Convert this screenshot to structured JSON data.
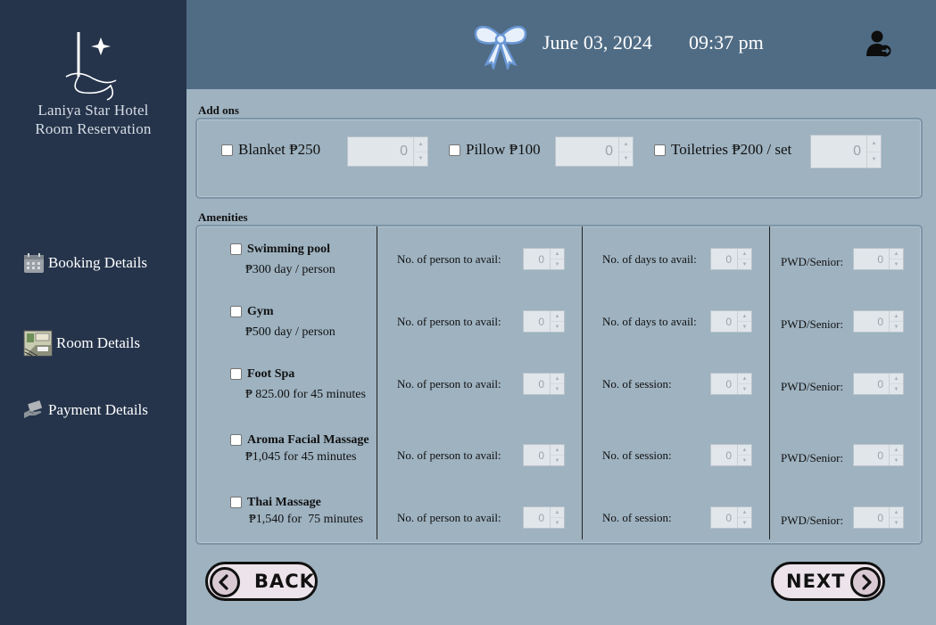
{
  "sidebar": {
    "hotel_name_line1": "Laniya Star Hotel",
    "hotel_name_line2": "Room Reservation",
    "nav": [
      {
        "label": "Booking Details",
        "icon": "calendar-icon"
      },
      {
        "label": "Room Details",
        "icon": "room-icon"
      },
      {
        "label": "Payment Details",
        "icon": "payment-icon"
      }
    ]
  },
  "header": {
    "date": "June 03, 2024",
    "time": "09:37 pm",
    "icons": [
      "bow-icon",
      "logout-user-icon"
    ]
  },
  "addons": {
    "section_label": "Add ons",
    "items": [
      {
        "label": "Blanket ₱250",
        "checked": false,
        "qty": "0"
      },
      {
        "label": "Pillow ₱100",
        "checked": false,
        "qty": "0"
      },
      {
        "label": "Toiletries ₱200 / set",
        "checked": false,
        "qty": "0"
      }
    ]
  },
  "amenities": {
    "section_label": "Amenities",
    "items": [
      {
        "name": "Swimming pool",
        "price": "₱300 day / person",
        "checked": false,
        "persons_label": "No. of person to avail:",
        "persons": "0",
        "second_label": "No. of days to avail:",
        "second": "0",
        "pwd_label": "PWD/Senior:",
        "pwd": "0"
      },
      {
        "name": "Gym",
        "price": "₱500 day / person",
        "checked": false,
        "persons_label": "No. of person to avail:",
        "persons": "0",
        "second_label": "No. of days to avail:",
        "second": "0",
        "pwd_label": "PWD/Senior:",
        "pwd": "0"
      },
      {
        "name": "Foot Spa",
        "price": "₱ 825.00 for 45 minutes",
        "checked": false,
        "persons_label": "No. of person to avail:",
        "persons": "0",
        "second_label": "No. of session:",
        "second": "0",
        "pwd_label": "PWD/Senior:",
        "pwd": "0"
      },
      {
        "name": "Aroma Facial Massage",
        "price": "₱1,045 for 45 minutes",
        "checked": false,
        "persons_label": "No. of person to avail:",
        "persons": "0",
        "second_label": "No. of session:",
        "second": "0",
        "pwd_label": "PWD/Senior:",
        "pwd": "0"
      },
      {
        "name": "Thai Massage",
        "price": "₱1,540 for  75 minutes",
        "checked": false,
        "persons_label": "No. of person to avail:",
        "persons": "0",
        "second_label": "No. of session:",
        "second": "0",
        "pwd_label": "PWD/Senior:",
        "pwd": "0"
      }
    ]
  },
  "buttons": {
    "back_label": "BACK",
    "next_label": "NEXT"
  },
  "colors": {
    "sidebar_bg": "#25344b",
    "header_bg": "#506c85",
    "content_bg": "#9eb2c0"
  }
}
